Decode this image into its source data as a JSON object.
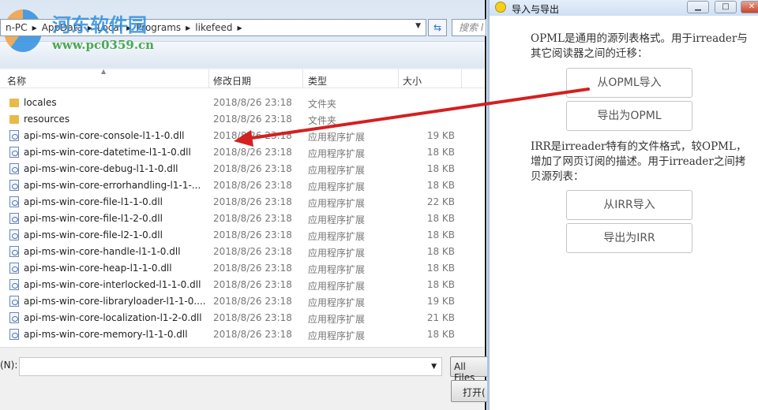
{
  "explorer": {
    "breadcrumb": [
      "n-PC",
      "AppData",
      "Local",
      "Programs",
      "likefeed"
    ],
    "search_placeholder": "搜索 l",
    "watermark": {
      "title": "河东软件园",
      "url": "www.pc0359.cn"
    },
    "columns": {
      "name": "名称",
      "date": "修改日期",
      "type": "类型",
      "size": "大小"
    },
    "files": [
      {
        "name": "locales",
        "date": "2018/8/26 23:18",
        "type": "文件夹",
        "size": "",
        "kind": "folder"
      },
      {
        "name": "resources",
        "date": "2018/8/26 23:18",
        "type": "文件夹",
        "size": "",
        "kind": "folder"
      },
      {
        "name": "api-ms-win-core-console-l1-1-0.dll",
        "date": "2018/8/26 23:18",
        "type": "应用程序扩展",
        "size": "19 KB",
        "kind": "dll"
      },
      {
        "name": "api-ms-win-core-datetime-l1-1-0.dll",
        "date": "2018/8/26 23:18",
        "type": "应用程序扩展",
        "size": "18 KB",
        "kind": "dll"
      },
      {
        "name": "api-ms-win-core-debug-l1-1-0.dll",
        "date": "2018/8/26 23:18",
        "type": "应用程序扩展",
        "size": "18 KB",
        "kind": "dll"
      },
      {
        "name": "api-ms-win-core-errorhandling-l1-1-...",
        "date": "2018/8/26 23:18",
        "type": "应用程序扩展",
        "size": "18 KB",
        "kind": "dll"
      },
      {
        "name": "api-ms-win-core-file-l1-1-0.dll",
        "date": "2018/8/26 23:18",
        "type": "应用程序扩展",
        "size": "22 KB",
        "kind": "dll"
      },
      {
        "name": "api-ms-win-core-file-l1-2-0.dll",
        "date": "2018/8/26 23:18",
        "type": "应用程序扩展",
        "size": "18 KB",
        "kind": "dll"
      },
      {
        "name": "api-ms-win-core-file-l2-1-0.dll",
        "date": "2018/8/26 23:18",
        "type": "应用程序扩展",
        "size": "18 KB",
        "kind": "dll"
      },
      {
        "name": "api-ms-win-core-handle-l1-1-0.dll",
        "date": "2018/8/26 23:18",
        "type": "应用程序扩展",
        "size": "18 KB",
        "kind": "dll"
      },
      {
        "name": "api-ms-win-core-heap-l1-1-0.dll",
        "date": "2018/8/26 23:18",
        "type": "应用程序扩展",
        "size": "18 KB",
        "kind": "dll"
      },
      {
        "name": "api-ms-win-core-interlocked-l1-1-0.dll",
        "date": "2018/8/26 23:18",
        "type": "应用程序扩展",
        "size": "18 KB",
        "kind": "dll"
      },
      {
        "name": "api-ms-win-core-libraryloader-l1-1-0....",
        "date": "2018/8/26 23:18",
        "type": "应用程序扩展",
        "size": "19 KB",
        "kind": "dll"
      },
      {
        "name": "api-ms-win-core-localization-l1-2-0.dll",
        "date": "2018/8/26 23:18",
        "type": "应用程序扩展",
        "size": "21 KB",
        "kind": "dll"
      },
      {
        "name": "api-ms-win-core-memory-l1-1-0.dll",
        "date": "2018/8/26 23:18",
        "type": "应用程序扩展",
        "size": "18 KB",
        "kind": "dll"
      }
    ],
    "filename_label": "(N):",
    "filename_value": "",
    "filetype": "All Files",
    "open_label": "打开("
  },
  "dialog": {
    "title": "导入与导出",
    "opml_desc": "OPML是通用的源列表格式。用于irreader与其它阅读器之间的迁移：",
    "import_opml": "从OPML导入",
    "export_opml": "导出为OPML",
    "irr_desc": "IRR是irreader特有的文件格式，较OPML，增加了网页订阅的描述。用于irreader之间拷贝源列表：",
    "import_irr": "从IRR导入",
    "export_irr": "导出为IRR"
  },
  "colors": {
    "arrow": "#d42020",
    "accent": "#2f8fe0"
  }
}
